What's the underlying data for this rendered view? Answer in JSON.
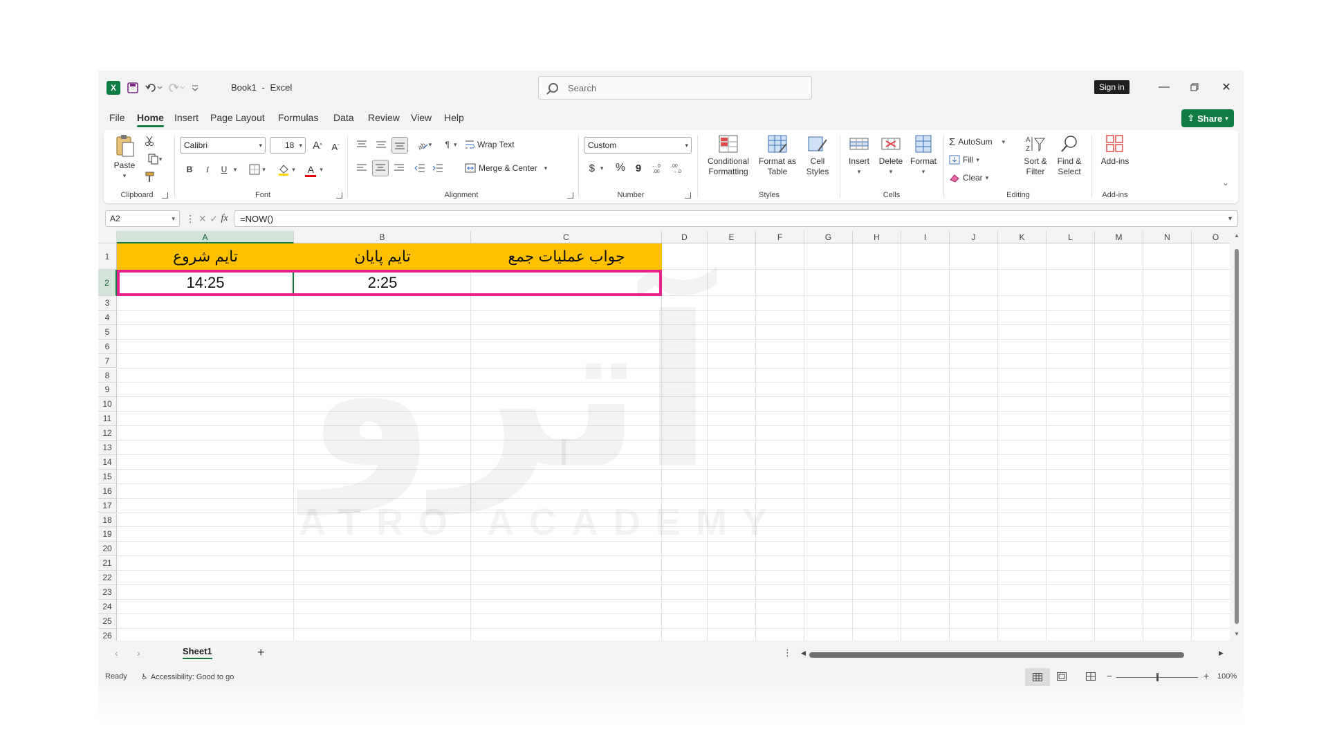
{
  "window": {
    "doc_name": "Book1",
    "app_name": "Excel",
    "title_sep": "-",
    "search_placeholder": "Search",
    "signin_label": "Sign in",
    "share_label": "Share"
  },
  "menu": {
    "tabs": [
      "File",
      "Home",
      "Insert",
      "Page Layout",
      "Formulas",
      "Data",
      "Review",
      "View",
      "Help"
    ],
    "active": "Home"
  },
  "ribbon": {
    "clipboard": {
      "label": "Clipboard",
      "paste": "Paste"
    },
    "font": {
      "label": "Font",
      "family": "Calibri",
      "size": "18",
      "bold": "B",
      "italic": "I",
      "underline": "U"
    },
    "alignment": {
      "label": "Alignment",
      "wrap_text": "Wrap Text",
      "merge_center": "Merge & Center"
    },
    "number": {
      "label": "Number",
      "format": "Custom",
      "currency": "$",
      "percent": "%",
      "comma": "9"
    },
    "styles": {
      "label": "Styles",
      "conditional": "Conditional Formatting",
      "format_table": "Format as Table",
      "cell_styles": "Cell Styles"
    },
    "cells": {
      "label": "Cells",
      "insert": "Insert",
      "delete": "Delete",
      "format": "Format"
    },
    "editing": {
      "label": "Editing",
      "autosum": "AutoSum",
      "fill": "Fill",
      "clear": "Clear",
      "sort_filter": "Sort & Filter",
      "find_select": "Find & Select"
    },
    "addins": {
      "label": "Add-ins",
      "addins": "Add-ins"
    }
  },
  "formula_bar": {
    "name_box": "A2",
    "fx": "fx",
    "formula": "=NOW()"
  },
  "grid": {
    "columns": [
      "A",
      "B",
      "C",
      "D",
      "E",
      "F",
      "G",
      "H",
      "I",
      "J",
      "K",
      "L",
      "M",
      "N",
      "O"
    ],
    "rows": [
      "1",
      "2",
      "3",
      "4",
      "5",
      "6",
      "7",
      "8",
      "9",
      "10",
      "11",
      "12",
      "13",
      "14",
      "15",
      "16",
      "17",
      "18",
      "19",
      "20",
      "21",
      "22",
      "23",
      "24",
      "25",
      "26"
    ],
    "cells": {
      "A1": "تایم شروع",
      "B1": "تایم پایان",
      "C1": "جواب عملیات جمع",
      "A2": "14:25",
      "B2": "2:25"
    }
  },
  "sheets": {
    "tabs": [
      "Sheet1"
    ],
    "add": "+"
  },
  "status": {
    "ready": "Ready",
    "accessibility": "Accessibility: Good to go",
    "zoom": "100%"
  },
  "watermark": {
    "text": "ATRO ACADEMY"
  },
  "colors": {
    "accent": "#107c41",
    "header_fill": "#ffc000",
    "highlight": "#e6218c"
  }
}
